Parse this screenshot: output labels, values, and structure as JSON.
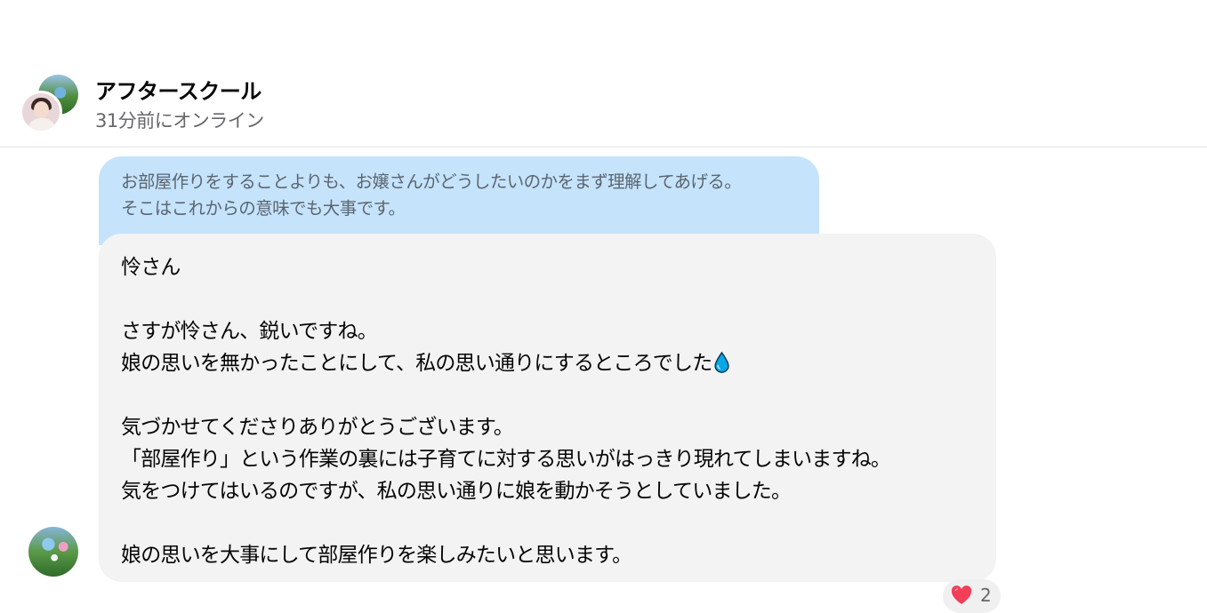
{
  "header": {
    "group_name": "アフタースクール",
    "status": "31分前にオンライン"
  },
  "quoted_reply": {
    "lines": [
      "お部屋作りをすることよりも、お嬢さんがどうしたいのかをまず理解してあげる。",
      "そこはこれからの意味でも大事です。"
    ]
  },
  "message": {
    "lines": [
      "怜さん",
      "",
      "さすが怜さん、鋭いですね。",
      "娘の思いを無かったことにして、私の思い通りにするところでした",
      "",
      "気づかせてくださりありがとうございます。",
      "「部屋作り」という作業の裏には子育てに対する思いがはっきり現れてしまいますね。",
      "気をつけてはいるのですが、私の思い通りに娘を動かそうとしていました。",
      "",
      "娘の思いを大事にして部屋作りを楽しみたいと思います。"
    ],
    "emoji_after_line_4": "droplet-icon"
  },
  "reaction": {
    "icon": "heart-icon",
    "count": "2",
    "color": "#f33e58"
  },
  "colors": {
    "quoted_bg": "#c5e3fb",
    "message_bg": "#f3f3f3",
    "drop": "#0aa6e8"
  }
}
